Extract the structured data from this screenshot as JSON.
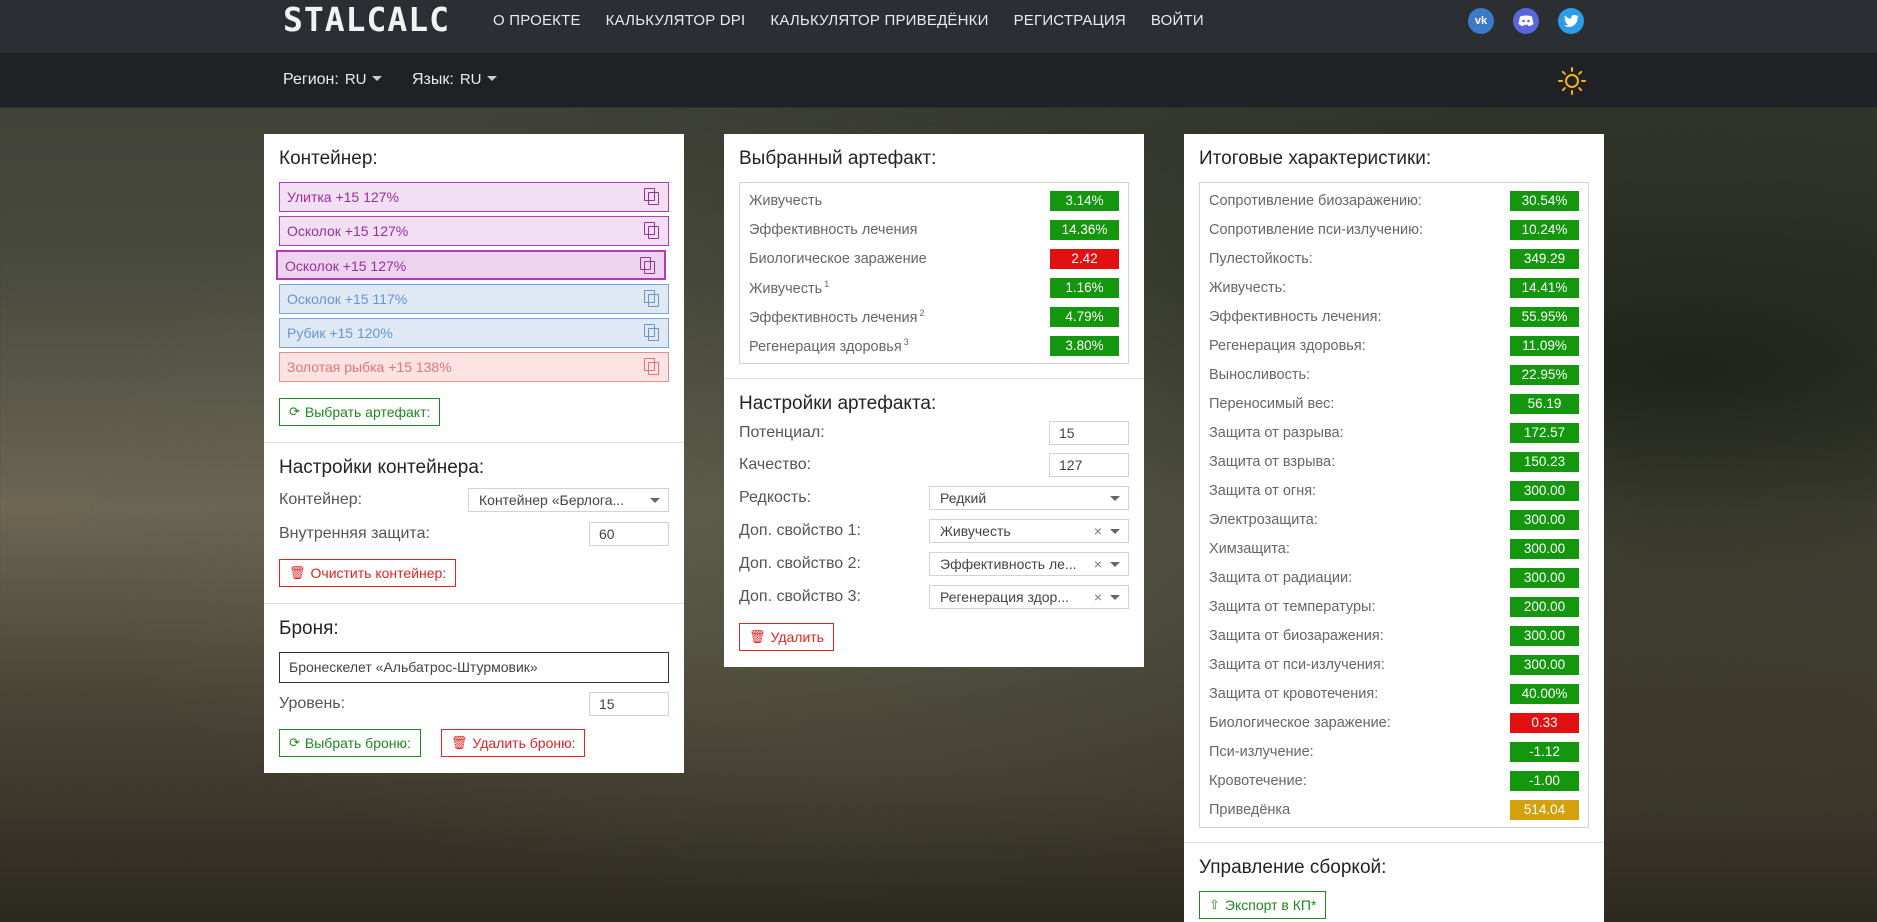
{
  "nav": {
    "logo": "STALCALC",
    "links": [
      "О ПРОЕКТЕ",
      "КАЛЬКУЛЯТОР DPI",
      "КАЛЬКУЛЯТОР ПРИВЕДЁНКИ",
      "РЕГИСТРАЦИЯ",
      "ВОЙТИ"
    ],
    "social": [
      "vk-icon",
      "discord-icon",
      "twitter-icon"
    ]
  },
  "subbar": {
    "region_label": "Регион:",
    "region_value": "RU",
    "language_label": "Язык:",
    "language_value": "RU"
  },
  "container_panel": {
    "title": "Контейнер:",
    "artifacts": [
      {
        "label": "Улитка +15 127%",
        "color": "#9a2fa0"
      },
      {
        "label": "Осколок +15 127%",
        "color": "#9a2fa0"
      },
      {
        "label": "Осколок +15 127%",
        "color": "#9a2fa0"
      },
      {
        "label": "Осколок +15 117%",
        "color": "#6b93cc"
      },
      {
        "label": "Рубик +15 120%",
        "color": "#6b93cc"
      },
      {
        "label": "Золотая рыбка +15 138%",
        "color": "#e57575"
      }
    ],
    "choose_artifact_button": "Выбрать артефакт:",
    "settings_title": "Настройки контейнера:",
    "container_label": "Контейнер:",
    "container_value": "Контейнер «Берлога...",
    "inner_protection_label": "Внутренняя защита:",
    "inner_protection_value": "60",
    "clear_button": "Очистить контейнер:",
    "armor_title": "Броня:",
    "armor_value": "Бронескелет «Альбатрос-Штурмовик»",
    "level_label": "Уровень:",
    "level_value": "15",
    "choose_armor_button": "Выбрать броню:",
    "delete_armor_button": "Удалить броню:"
  },
  "artifact_panel": {
    "title": "Выбранный артефакт:",
    "stats": [
      {
        "label": "Живучесть",
        "sup": "",
        "value": "3.14%",
        "color": "g"
      },
      {
        "label": "Эффективность лечения",
        "sup": "",
        "value": "14.36%",
        "color": "g"
      },
      {
        "label": "Биологическое заражение",
        "sup": "",
        "value": "2.42",
        "color": "r"
      },
      {
        "label": "Живучесть",
        "sup": "1",
        "value": "1.16%",
        "color": "g"
      },
      {
        "label": "Эффективность лечения",
        "sup": "2",
        "value": "4.79%",
        "color": "g"
      },
      {
        "label": "Регенерация здоровья",
        "sup": "3",
        "value": "3.80%",
        "color": "g"
      }
    ],
    "settings_title": "Настройки артефакта:",
    "potential_label": "Потенциал:",
    "potential_value": "15",
    "quality_label": "Качество:",
    "quality_value": "127",
    "rarity_label": "Редкость:",
    "rarity_value": "Редкий",
    "extra1_label": "Доп. свойство 1:",
    "extra1_value": "Живучесть",
    "extra2_label": "Доп. свойство 2:",
    "extra2_value": "Эффективность ле...",
    "extra3_label": "Доп. свойство 3:",
    "extra3_value": "Регенерация здор...",
    "delete_button": "Удалить"
  },
  "totals_panel": {
    "title": "Итоговые характеристики:",
    "stats": [
      {
        "label": "Сопротивление биозаражению:",
        "value": "30.54%",
        "color": "g"
      },
      {
        "label": "Сопротивление пси-излучению:",
        "value": "10.24%",
        "color": "g"
      },
      {
        "label": "Пулестойкость:",
        "value": "349.29",
        "color": "g"
      },
      {
        "label": "Живучесть:",
        "value": "14.41%",
        "color": "g"
      },
      {
        "label": "Эффективность лечения:",
        "value": "55.95%",
        "color": "g"
      },
      {
        "label": "Регенерация здоровья:",
        "value": "11.09%",
        "color": "g"
      },
      {
        "label": "Выносливость:",
        "value": "22.95%",
        "color": "g"
      },
      {
        "label": "Переносимый вес:",
        "value": "56.19",
        "color": "g"
      },
      {
        "label": "Защита от разрыва:",
        "value": "172.57",
        "color": "g"
      },
      {
        "label": "Защита от взрыва:",
        "value": "150.23",
        "color": "g"
      },
      {
        "label": "Защита от огня:",
        "value": "300.00",
        "color": "g"
      },
      {
        "label": "Электрозащита:",
        "value": "300.00",
        "color": "g"
      },
      {
        "label": "Химзащита:",
        "value": "300.00",
        "color": "g"
      },
      {
        "label": "Защита от радиации:",
        "value": "300.00",
        "color": "g"
      },
      {
        "label": "Защита от температуры:",
        "value": "200.00",
        "color": "g"
      },
      {
        "label": "Защита от биозаражения:",
        "value": "300.00",
        "color": "g"
      },
      {
        "label": "Защита от пси-излучения:",
        "value": "300.00",
        "color": "g"
      },
      {
        "label": "Защита от кровотечения:",
        "value": "40.00%",
        "color": "g"
      },
      {
        "label": "Биологическое заражение:",
        "value": "0.33",
        "color": "r"
      },
      {
        "label": "Пси-излучение:",
        "value": "-1.12",
        "color": "g"
      },
      {
        "label": "Кровотечение:",
        "value": "-1.00",
        "color": "g"
      },
      {
        "label": "Приведёнка",
        "value": "514.04",
        "color": "y"
      }
    ],
    "build_title": "Управление сборкой:",
    "export_button": "Экспорт в КП*"
  },
  "colors": {
    "green": "#15960f",
    "red": "#e21010",
    "yellow": "#d4a10c"
  }
}
